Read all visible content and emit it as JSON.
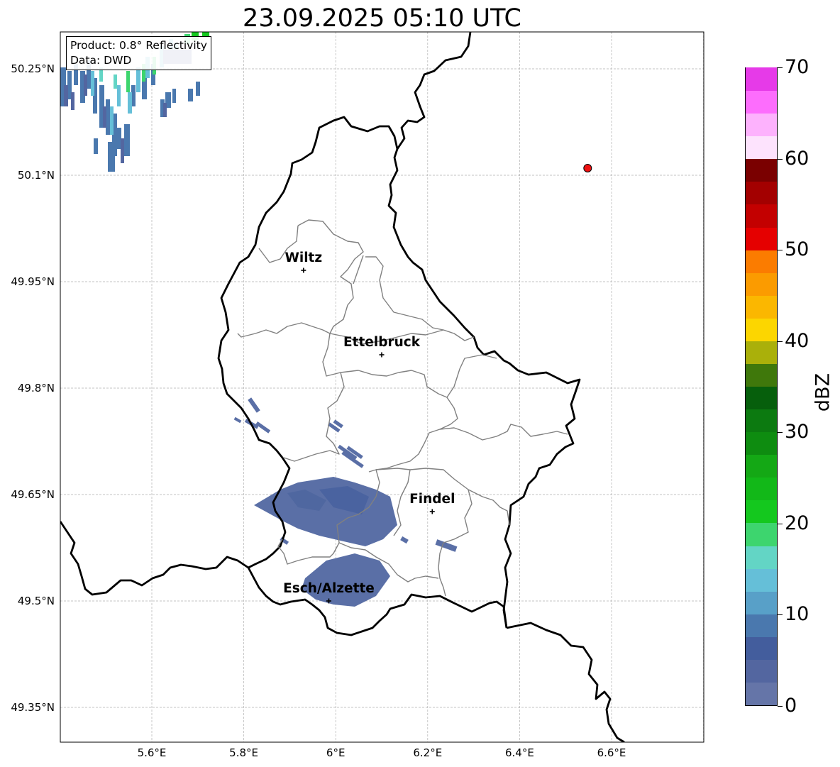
{
  "title": "23.09.2025 05:10 UTC",
  "info": {
    "product": "Product: 0.8° Reflectivity",
    "data": "Data: DWD"
  },
  "lat_labels": [
    "50.25°N",
    "50.1°N",
    "49.95°N",
    "49.8°N",
    "49.65°N",
    "49.5°N",
    "49.35°N"
  ],
  "lon_labels": [
    "5.6°E",
    "5.8°E",
    "6°E",
    "6.2°E",
    "6.4°E",
    "6.6°E"
  ],
  "cities": [
    {
      "name": "Wiltz",
      "lon": 5.93,
      "lat": 49.966
    },
    {
      "name": "Ettelbruck",
      "lon": 6.1,
      "lat": 49.847
    },
    {
      "name": "Findel",
      "lon": 6.21,
      "lat": 49.626
    },
    {
      "name": "Esch/Alzette",
      "lon": 5.985,
      "lat": 49.5
    }
  ],
  "radar_site": {
    "lon": 6.548,
    "lat": 50.11,
    "color": "#ee1111"
  },
  "colorbar": {
    "label": "dBZ",
    "min": 0,
    "max": 70,
    "step": 2.5,
    "tick_labels": [
      "0",
      "10",
      "20",
      "30",
      "40",
      "50",
      "60",
      "70"
    ],
    "colors": [
      "#6575a8",
      "#5366a0",
      "#435d9d",
      "#4a78ae",
      "#58a0c8",
      "#65bfd8",
      "#63d5c5",
      "#3dd56e",
      "#14c81e",
      "#12b818",
      "#14a815",
      "#0e8c10",
      "#0c7a10",
      "#065f0c",
      "#3f780b",
      "#aab00a",
      "#fcd600",
      "#fbb700",
      "#fb9b00",
      "#fb7c00",
      "#e50000",
      "#c30000",
      "#a30000",
      "#7a0000",
      "#fde3fd",
      "#fdb2fd",
      "#fd6dfd",
      "#e63ae8"
    ]
  }
}
